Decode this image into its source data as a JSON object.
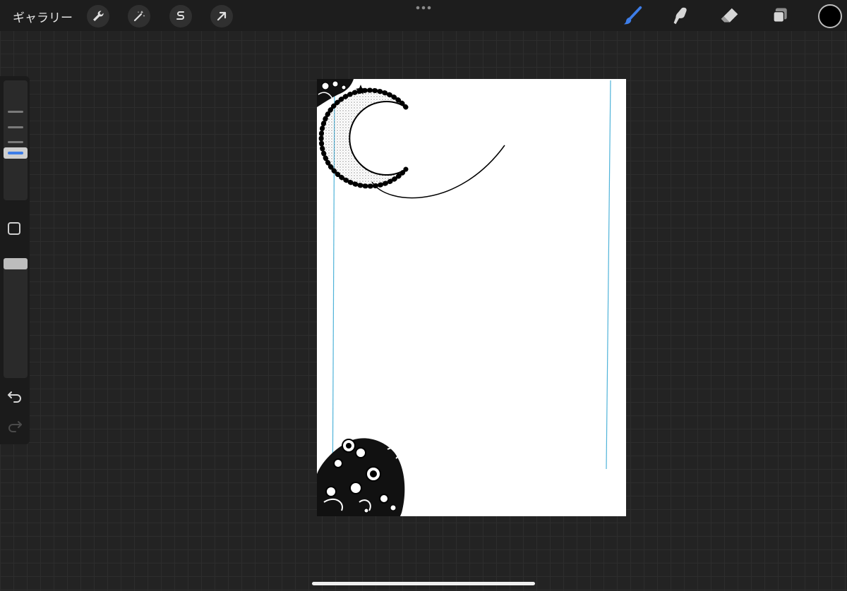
{
  "topbar": {
    "gallery_label": "ギャラリー",
    "left_tools": [
      "wrench-icon",
      "magic-wand-icon",
      "selection-icon",
      "transform-arrow-icon"
    ],
    "right_tools": [
      "brush-icon",
      "smudge-icon",
      "eraser-icon",
      "layers-icon"
    ],
    "active_tool": "brush-icon",
    "active_color": "#000000",
    "accent_color": "#3d7de8"
  },
  "sidebar": {
    "controls": [
      "brush-size-slider",
      "modify-button",
      "opacity-slider",
      "undo-icon",
      "redo-icon"
    ]
  },
  "canvas": {
    "background": "#ffffff",
    "guide_color": "#4fb3d9"
  }
}
